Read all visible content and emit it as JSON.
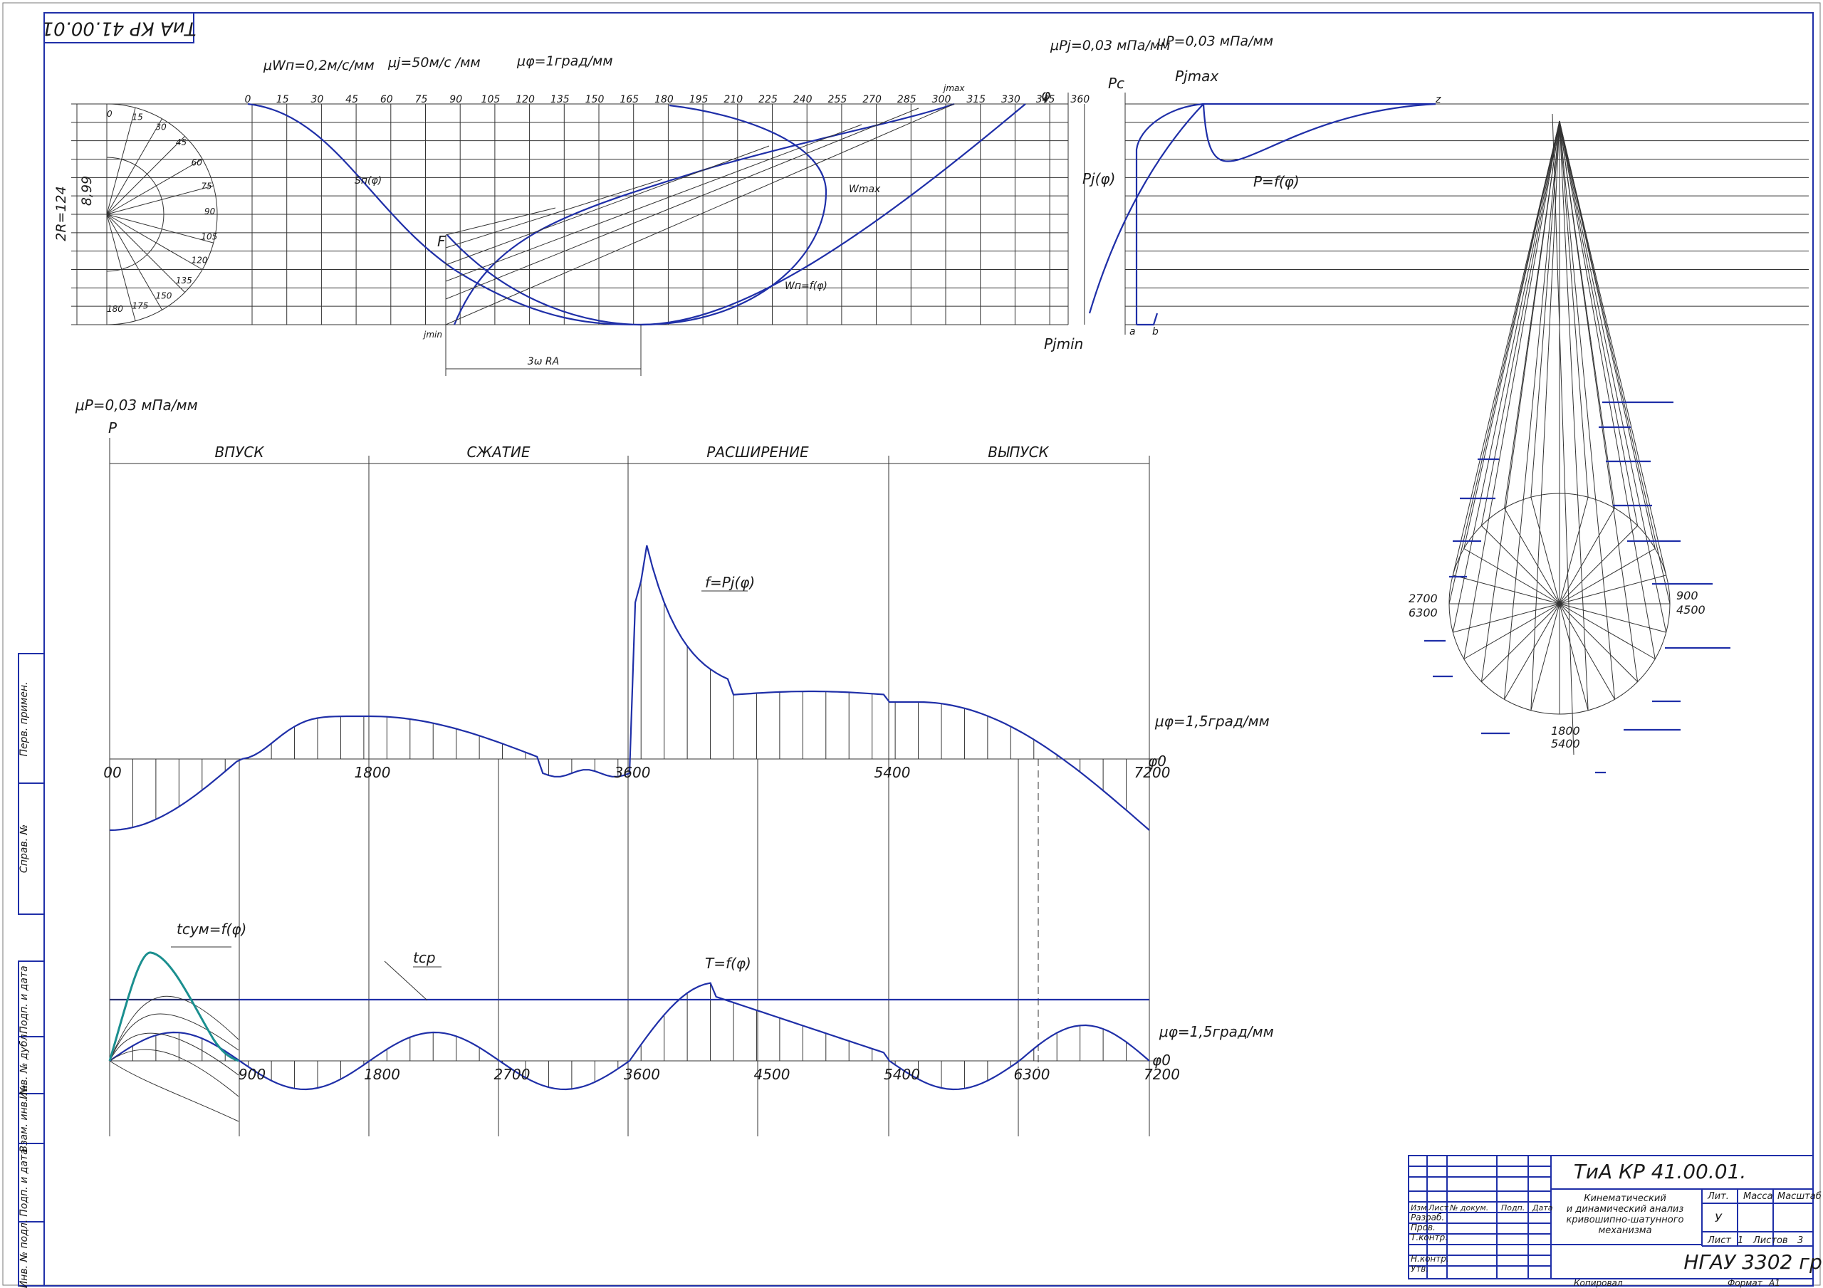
{
  "stamp_code_rotated": "ТиА КР 41.00.01",
  "top": {
    "scale_w": "μWп=0,2м/с/мм",
    "scale_j": "μj=50м/с /мм",
    "scale_phi": "μφ=1град/мм",
    "scale_pj": "μPj=0,03 мПа/мм",
    "scale_p": "μP=0,03 мПа/мм",
    "dim_stroke": "2R=124",
    "dim_small": "8,99",
    "angle_ticks": [
      "0",
      "15",
      "30",
      "45",
      "60",
      "75",
      "90",
      "105",
      "120",
      "135",
      "150",
      "165",
      "180",
      "195",
      "210",
      "225",
      "240",
      "255",
      "270",
      "285",
      "300",
      "315",
      "330",
      "345",
      "360"
    ],
    "phi_symbol": "φ",
    "semicircle_ticks": [
      "0",
      "15",
      "30",
      "45",
      "60",
      "75",
      "90",
      "105",
      "120",
      "135",
      "150",
      "175",
      "180"
    ],
    "curve_label_s": "Sп(φ)",
    "curve_label_w": "Wп=f(φ)",
    "curve_label_wmax": "Wmax",
    "curve_label_jmax": "jmax",
    "curve_label_jmin": "jmin",
    "label_f": "F",
    "dim_3wra": "3ω RA",
    "label_pc": "Pc",
    "label_pjmax": "Pjmax",
    "label_pjmin": "Pjmin",
    "label_pj_phi": "Pj(φ)",
    "label_p_f": "P=f(φ)",
    "label_z": "z",
    "label_a": "a",
    "label_b": "b"
  },
  "middle": {
    "scale_p": "μP=0,03 мПа/мм",
    "axis_p": "P",
    "phases": [
      "ВПУСК",
      "СЖАТИЕ",
      "РАСШИРЕНИЕ",
      "ВЫПУСК"
    ],
    "curve_label": "f=Pj(φ)",
    "scale_phi": "μφ=1,5град/мм",
    "axis_phi": "φ0",
    "ticks": [
      "00",
      "1800",
      "3600",
      "5400",
      "7200"
    ]
  },
  "bottom": {
    "curve_t": "T=f(φ)",
    "curve_tsum": "tсум=f(φ)",
    "curve_tcp": "tср",
    "scale_phi": "μφ=1,5град/мм",
    "axis_phi": "φ0",
    "ticks": [
      "900",
      "1800",
      "2700",
      "3600",
      "4500",
      "5400",
      "6300",
      "7200"
    ]
  },
  "polar": {
    "labels_left": [
      "2700",
      "6300"
    ],
    "labels_right": [
      "900",
      "4500"
    ],
    "labels_bottom": [
      "1800",
      "5400"
    ]
  },
  "side_stamps": [
    "Перв. примен.",
    "Справ. №",
    "Подп. и дата",
    "Инв. № дубл.",
    "Взам. инв. №",
    "Подп. и дата",
    "Инв. № подл."
  ],
  "title_block": {
    "code": "ТиА КР 41.00.01.",
    "title_lines": [
      "Кинематический",
      "и динамический анализ",
      "кривошипно-шатунного",
      "механизма"
    ],
    "col_headers": [
      "Изм.",
      "Лист",
      "№ докум.",
      "Подп.",
      "Дата"
    ],
    "rows": [
      "Разраб.",
      "Пров.",
      "Т.контр.",
      "",
      "Н.контр.",
      "Утв."
    ],
    "right_headers": [
      "Лит.",
      "Масса",
      "Масштаб"
    ],
    "lit_value": "У",
    "sheet": "Лист",
    "sheet_num": "1",
    "sheets": "Листов",
    "sheets_num": "3",
    "org": "НГАУ 3302 гр.",
    "copied": "Копировал",
    "format": "Формат",
    "format_value": "А1"
  }
}
